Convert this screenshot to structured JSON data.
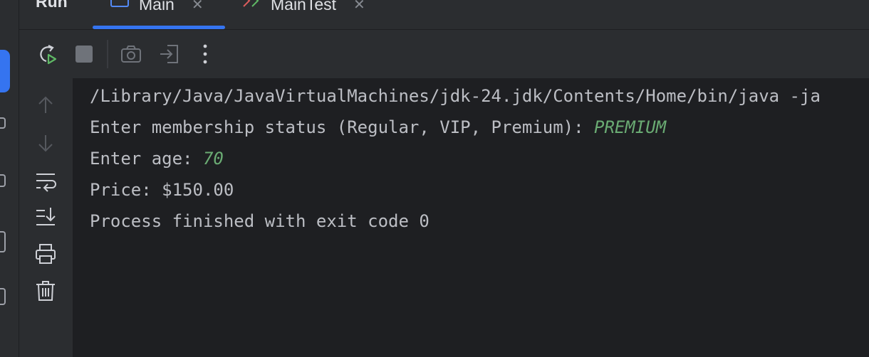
{
  "tool_window": {
    "title": "Run"
  },
  "tabs": [
    {
      "label": "Main",
      "icon": "application-config-icon",
      "active": true
    },
    {
      "label": "MainTest",
      "icon": "test-config-icon",
      "active": false
    }
  ],
  "toolbar": {
    "buttons": [
      "rerun-icon",
      "stop-icon",
      "camera-icon",
      "attach-icon",
      "more-icon"
    ]
  },
  "side_actions": [
    "arrow-up-icon",
    "arrow-down-icon",
    "soft-wrap-icon",
    "scroll-to-end-icon",
    "print-icon",
    "trash-icon"
  ],
  "console": {
    "command": "/Library/Java/JavaVirtualMachines/jdk-24.jdk/Contents/Home/bin/java -ja",
    "prompt1": "Enter membership status (Regular, VIP, Premium): ",
    "input1": "PREMIUM",
    "prompt2": "Enter age: ",
    "input2": "70",
    "price_line": "Price: $150.00",
    "exit_line": "Process finished with exit code 0"
  },
  "colors": {
    "accent": "#3574f0",
    "user_input": "#6aab73",
    "console_text": "#bcbec4",
    "background": "#1e1f22",
    "panel": "#2b2d30"
  }
}
